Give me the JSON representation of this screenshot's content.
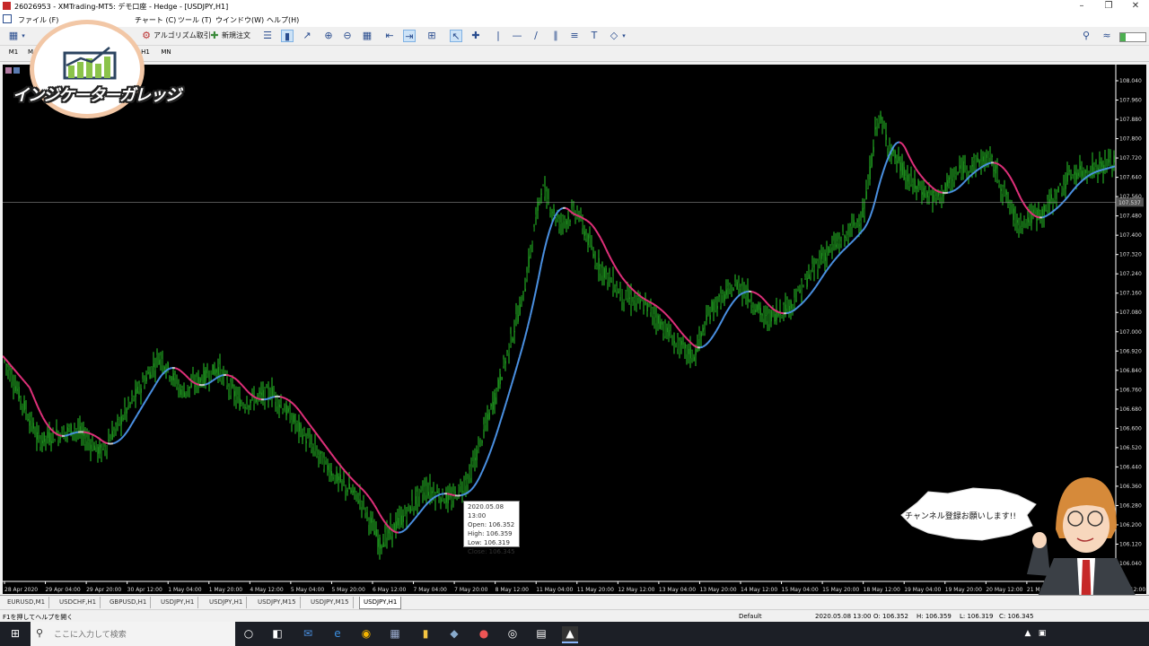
{
  "window": {
    "title": "26026953 - XMTrading-MT5: デモ口座 - Hedge - [USDJPY,H1]",
    "min_icon": "minimize-icon",
    "max_icon": "restore-icon",
    "close_icon": "close-icon"
  },
  "menu": {
    "items": [
      "ファイル (F)",
      "チャート (C)",
      "ツール (T)",
      "ウインドウ(W)",
      "ヘルプ(H)"
    ]
  },
  "toolbar": {
    "algo_label": "アルゴリズム取引",
    "new_order_label": "新規注文"
  },
  "timeframes": [
    "M1",
    "M",
    "H1",
    "MN"
  ],
  "logo": {
    "text": "インジケーターガレッジ"
  },
  "chart": {
    "symbol": "USDJPY,H1",
    "current_price_label": "107.537",
    "price_ticks": [
      "108.040",
      "107.960",
      "107.880",
      "107.800",
      "107.720",
      "107.640",
      "107.560",
      "107.480",
      "107.400",
      "107.320",
      "107.240",
      "107.160",
      "107.080",
      "107.000",
      "106.920",
      "106.840",
      "106.760",
      "106.680",
      "106.600",
      "106.520",
      "106.440",
      "106.360",
      "106.280",
      "106.200",
      "106.120",
      "106.040"
    ],
    "time_ticks": [
      "28 Apr 2020",
      "29 Apr 04:00",
      "29 Apr 20:00",
      "30 Apr 12:00",
      "1 May 04:00",
      "1 May 20:00",
      "4 May 12:00",
      "5 May 04:00",
      "5 May 20:00",
      "6 May 12:00",
      "7 May 04:00",
      "7 May 20:00",
      "8 May 12:00",
      "11 May 04:00",
      "11 May 20:00",
      "12 May 12:00",
      "13 May 04:00",
      "13 May 20:00",
      "14 May 12:00",
      "15 May 04:00",
      "15 May 20:00",
      "18 May 12:00",
      "19 May 04:00",
      "19 May 20:00",
      "20 May 12:00",
      "21 May 04:00",
      "21 May 20:00",
      "22 May 12:00"
    ],
    "up_color": "#28c828",
    "down_color": "#28c828",
    "ma_up_color": "#4a90e2",
    "ma_down_color": "#e0307a",
    "ma_flat_color": "#c8c8c8"
  },
  "tooltip": {
    "time": "2020.05.08 13:00",
    "open": "Open: 106.352",
    "high": "High: 106.359",
    "low": "Low: 106.319",
    "close": "Close: 106.345"
  },
  "bubble": {
    "text": "チャンネル登録お願いします!!"
  },
  "chart_tabs": [
    "EURUSD,M1",
    "USDCHF,H1",
    "GBPUSD,H1",
    "USDJPY,H1",
    "USDJPY,H1",
    "USDJPY,M15",
    "USDJPY,M15",
    "USDJPY,H1"
  ],
  "active_tab_index": 7,
  "status": {
    "help": "F1を押してヘルプを開く",
    "profile": "Default",
    "time": "2020.05.08 13:00",
    "open": "O: 106.352",
    "high": "H: 106.359",
    "low": "L: 106.319",
    "close": "C: 106.345"
  },
  "taskbar": {
    "search_placeholder": "ここに入力して検索"
  }
}
